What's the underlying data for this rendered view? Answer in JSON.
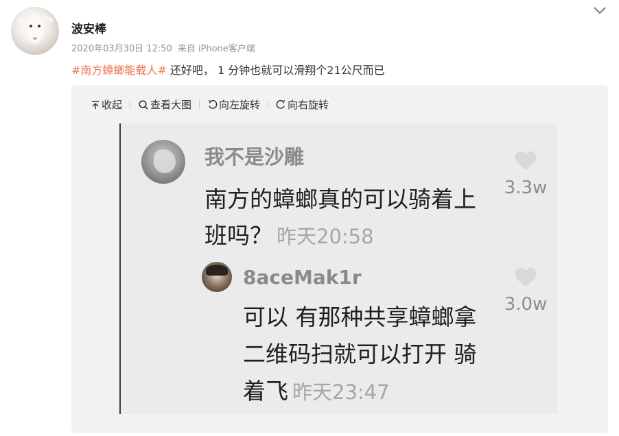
{
  "post": {
    "username": "波安棒",
    "date": "2020年03月30日 12:50",
    "source": "来自 iPhone客户端",
    "topic": "#南方蟑螂能载人#",
    "text": " 还好吧， 1 分钟也就可以滑翔个21公尺而已"
  },
  "toolbar": {
    "collapse": "收起",
    "view_large": "查看大图",
    "rotate_left": "向左旋转",
    "rotate_right": "向右旋转"
  },
  "screenshot": {
    "comment1": {
      "name": "我不是沙雕",
      "text": "南方的蟑螂真的可以骑着上班吗？",
      "time": "昨天20:58",
      "likes": "3.3w"
    },
    "comment2": {
      "name": "8aceMak1r",
      "text": "可以 有那种共享蟑螂拿二维码扫就可以打开 骑着飞",
      "time": "昨天23:47",
      "likes": "3.0w"
    }
  },
  "icons": [
    "chevron-down-icon",
    "collapse-icon",
    "magnifier-icon",
    "rotate-left-icon",
    "rotate-right-icon",
    "heart-icon"
  ],
  "colors": {
    "topic": "#eb7350",
    "meta": "#939393",
    "card_bg": "#f2f2f5"
  }
}
